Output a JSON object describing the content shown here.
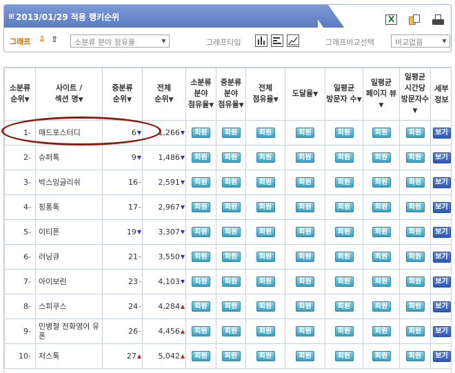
{
  "header": {
    "title": "2013/01/29 적용 랭키순위",
    "graph_label": "그래프",
    "graph_type_label": "그래프타입",
    "graph_compare_label": "그래프비교선택",
    "category_select_value": "소분류 분야 점유율",
    "compare_select_value": "비교없음",
    "icons": [
      "excel-icon",
      "copy-icon",
      "print-icon",
      "arrow-down-icon",
      "arrow-up-icon",
      "bar-chart-icon",
      "hbar-chart-icon",
      "line-chart-icon"
    ]
  },
  "table": {
    "columns": [
      {
        "id": "small_rank",
        "label": "소분류\n순위",
        "sortable": true
      },
      {
        "id": "site",
        "label": "사이트 /\n섹션 명",
        "sortable": true
      },
      {
        "id": "mid_rank",
        "label": "중분류\n순위",
        "sortable": true
      },
      {
        "id": "total_rank",
        "label": "전체\n순위",
        "sortable": true
      },
      {
        "id": "small_share",
        "label": "소분류\n분야\n점유율",
        "sortable": true
      },
      {
        "id": "mid_share",
        "label": "중분류\n분야\n점유율",
        "sortable": true
      },
      {
        "id": "total_share",
        "label": "전체\n점유율",
        "sortable": true
      },
      {
        "id": "reach",
        "label": "도달율",
        "sortable": true
      },
      {
        "id": "daily_visitors",
        "label": "일평균\n방문자 수",
        "sortable": true
      },
      {
        "id": "daily_pageviews",
        "label": "일평균\n페이지 뷰",
        "sortable": true
      },
      {
        "id": "time_per_visitor",
        "label": "일평균\n시간당\n방문자수",
        "sortable": true
      },
      {
        "id": "detail",
        "label": "세부\n정보",
        "sortable": false
      }
    ],
    "member_label": "회원",
    "view_label": "보기",
    "rows": [
      {
        "rank": "1-",
        "site": "매드포스터디",
        "mid_rank": "6",
        "mid_trend": "down",
        "total_rank": "1,266",
        "total_trend": "down"
      },
      {
        "rank": "2-",
        "site": "슈퍼톡",
        "mid_rank": "9",
        "mid_trend": "down",
        "total_rank": "1,486",
        "total_trend": "down"
      },
      {
        "rank": "3-",
        "site": "박스잉글리쉬",
        "mid_rank": "16",
        "mid_trend": "flat",
        "total_rank": "2,591",
        "total_trend": "down"
      },
      {
        "rank": "4-",
        "site": "핑퐁톡",
        "mid_rank": "17",
        "mid_trend": "flat",
        "total_rank": "2,967",
        "total_trend": "down"
      },
      {
        "rank": "5-",
        "site": "이티폰",
        "mid_rank": "19",
        "mid_trend": "down",
        "total_rank": "3,307",
        "total_trend": "down"
      },
      {
        "rank": "6-",
        "site": "러닝큐",
        "mid_rank": "21",
        "mid_trend": "flat",
        "total_rank": "3,550",
        "total_trend": "down"
      },
      {
        "rank": "7-",
        "site": "아이보린",
        "mid_rank": "23",
        "mid_trend": "flat",
        "total_rank": "4,103",
        "total_trend": "down"
      },
      {
        "rank": "8-",
        "site": "스피쿠스",
        "mid_rank": "24",
        "mid_trend": "flat",
        "total_rank": "4,284",
        "total_trend": "up"
      },
      {
        "rank": "9-",
        "site": "민병철 전화영어 유폰",
        "mid_rank": "26",
        "mid_trend": "flat",
        "total_rank": "4,456",
        "total_trend": "up"
      },
      {
        "rank": "10-",
        "site": "저스톡",
        "mid_rank": "27",
        "mid_trend": "up",
        "total_rank": "5,042",
        "total_trend": "up"
      }
    ]
  },
  "colors": {
    "title_bar": "#6b8bcf",
    "graph_label": "#d06a00",
    "member_badge": "#3c9fc0",
    "view_button": "#2f58b5",
    "trend_down": "#3333aa",
    "trend_up": "#cc2222",
    "highlight_circle": "#8b1d10"
  }
}
